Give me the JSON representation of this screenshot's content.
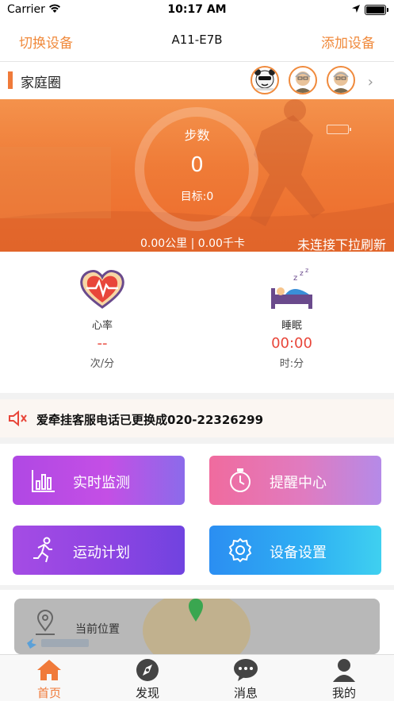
{
  "status_bar": {
    "carrier": "Carrier",
    "time": "10:17 AM"
  },
  "nav": {
    "left_label": "切换设备",
    "title": "A11-E7B",
    "right_label": "添加设备"
  },
  "family": {
    "title": "家庭圈"
  },
  "hero": {
    "steps_label": "步数",
    "steps_value": "0",
    "target_text": "目标:0",
    "stats_text": "0.00公里 | 0.00千卡",
    "refresh_text": "未连接下拉刷新"
  },
  "vitals": {
    "heart": {
      "name": "心率",
      "value": "--",
      "unit": "次/分"
    },
    "sleep": {
      "name": "睡眠",
      "value": "00:00",
      "unit": "时:分"
    }
  },
  "notice": {
    "text": "爱牵挂客服电话已更换成020-22326299"
  },
  "tiles": [
    {
      "label": "实时监测",
      "icon": "bar-chart-icon"
    },
    {
      "label": "提醒中心",
      "icon": "stopwatch-icon"
    },
    {
      "label": "运动计划",
      "icon": "running-icon"
    },
    {
      "label": "设备设置",
      "icon": "gear-icon"
    }
  ],
  "location": {
    "label": "当前位置"
  },
  "tabbar": [
    {
      "label": "首页",
      "icon": "home-icon",
      "active": true
    },
    {
      "label": "发现",
      "icon": "compass-icon",
      "active": false
    },
    {
      "label": "消息",
      "icon": "message-icon",
      "active": false
    },
    {
      "label": "我的",
      "icon": "profile-icon",
      "active": false
    }
  ],
  "colors": {
    "accent": "#f07a3a",
    "danger": "#e8463a"
  }
}
